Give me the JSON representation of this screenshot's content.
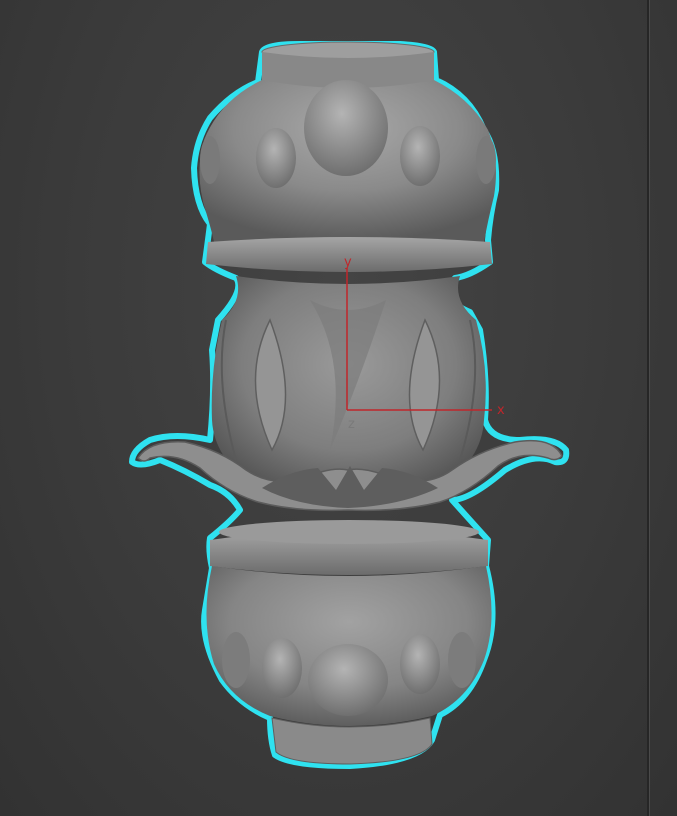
{
  "viewport": {
    "selection_outline_color": "#2fe2f0",
    "model_color": "#8c8c8c",
    "axis_color": "#c0262b",
    "axis_z_color": "#7a7a7a",
    "background_color": "#3a3a3a"
  },
  "gizmo": {
    "x_label": "x",
    "y_label": "y",
    "z_label": "z"
  },
  "model": {
    "icon": "lamp-post-3d-model"
  }
}
